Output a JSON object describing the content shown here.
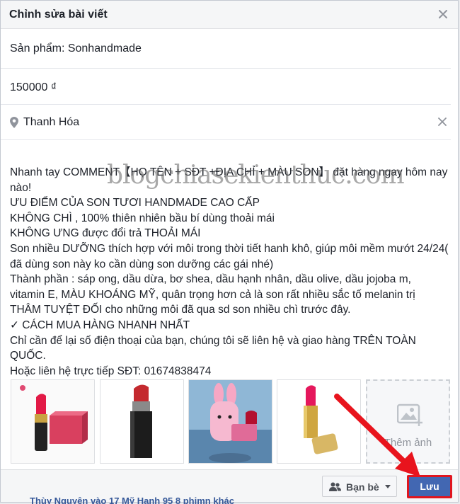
{
  "dialog": {
    "title": "Chỉnh sửa bài viết",
    "close_icon": "close-icon"
  },
  "fields": {
    "product": "Sản phẩm: Sonhandmade",
    "price": "150000 ₫",
    "location": "Thanh Hóa"
  },
  "post": {
    "lines": [
      " Nhanh tay COMMENT【HỌ TÊN + SĐT +ĐỊA CHỈ + MÀU SON】 đặt hàng ngay hôm nay nào!",
      "ƯU ĐIỂM CỦA SON TƯƠI HANDMADE CAO CẤP",
      "KHÔNG CHÌ , 100% thiên nhiên bầu bí dùng thoải mái",
      "KHÔNG ƯNG được đổi trả THOẢI MÁI",
      "Son nhiều DƯỠNG thích hợp với môi trong thời tiết hanh khô, giúp môi mềm mướt 24/24( đã dùng son này ko cần dùng son dưỡng các gái nhé)",
      "Thành phần : sáp ong, dầu dừa, bơ shea, dầu hạnh nhân, dầu olive, dầu jojoba m, vitamin E, MÀU KHOÁNG MỸ, quân trọng hơn cả là son rất nhiều sắc tố melanin trị THÂM TUYỆT ĐỐI cho những môi đã qua sd son nhiều chì trước đây.",
      "✓ CÁCH MUA HÀNG NHANH NHẤT",
      "Chỉ cần để lại số điện thoại của bạn, chúng tôi sẽ liên hệ và giao hàng TRÊN TOÀN QUỐC.",
      "Hoặc liên hệ trực tiếp SĐT: 01674838474"
    ]
  },
  "watermark": "blogchiasekienthuc.com",
  "photos": {
    "add_label": "Thêm ảnh"
  },
  "footer": {
    "audience_label": "Bạn bè",
    "save_label": "Lưu"
  },
  "background": {
    "partial_text": "Thùy Nguyên  vào 17 Mỹ Hạnh 95 8 phimn khác"
  },
  "colors": {
    "primary_button": "#4267b2",
    "highlight_border": "#e0161f",
    "annotation_arrow": "#e8141d"
  }
}
